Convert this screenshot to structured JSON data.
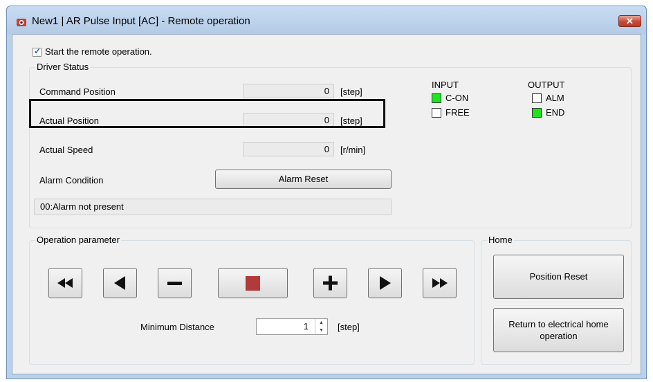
{
  "window": {
    "title": "New1 | AR Pulse Input [AC] - Remote operation",
    "close_glyph": "✕"
  },
  "remote": {
    "label": "Start the remote operation.",
    "checked": true
  },
  "driver_status": {
    "caption": "Driver Status",
    "command_position": {
      "label": "Command Position",
      "value": "0",
      "unit": "[step]"
    },
    "actual_position": {
      "label": "Actual Position",
      "value": "0",
      "unit": "[step]"
    },
    "actual_speed": {
      "label": "Actual Speed",
      "value": "0",
      "unit": "[r/min]"
    },
    "alarm_condition_label": "Alarm Condition",
    "alarm_reset_label": "Alarm Reset",
    "alarm_text": "00:Alarm not present",
    "input": {
      "header": "INPUT",
      "items": [
        {
          "label": "C-ON",
          "on": true
        },
        {
          "label": "FREE",
          "on": false
        }
      ]
    },
    "output": {
      "header": "OUTPUT",
      "items": [
        {
          "label": "ALM",
          "on": false
        },
        {
          "label": "END",
          "on": true
        }
      ]
    }
  },
  "operation": {
    "caption": "Operation parameter",
    "buttons": [
      {
        "name": "fast-reverse",
        "icon": "double-left-arrow-icon"
      },
      {
        "name": "reverse",
        "icon": "left-triangle-icon"
      },
      {
        "name": "jog-minus",
        "icon": "minus-icon"
      },
      {
        "name": "stop",
        "icon": "stop-square-icon"
      },
      {
        "name": "jog-plus",
        "icon": "plus-icon"
      },
      {
        "name": "forward",
        "icon": "right-triangle-icon"
      },
      {
        "name": "fast-forward",
        "icon": "double-right-arrow-icon"
      }
    ],
    "min_distance_label": "Minimum Distance",
    "min_distance_value": "1",
    "min_distance_unit": "[step]"
  },
  "home": {
    "caption": "Home",
    "position_reset_label": "Position Reset",
    "return_home_label": "Return to electrical home operation"
  },
  "colors": {
    "indicator_on": "#21e321",
    "stop_icon": "#b33a3a",
    "title_bar": "#b9d1ea"
  }
}
